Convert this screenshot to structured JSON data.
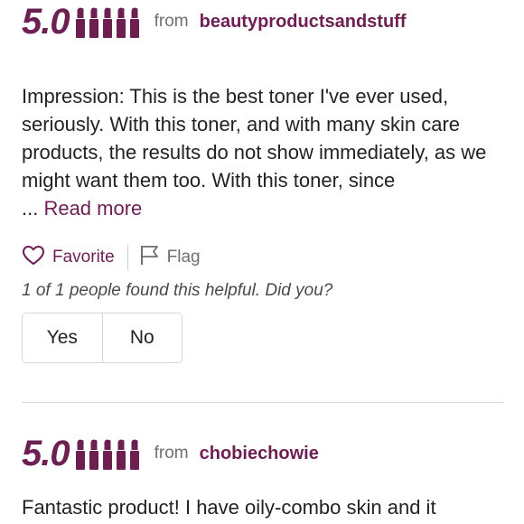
{
  "reviews": [
    {
      "score": "5.0",
      "rating": 5,
      "from_label": "from",
      "username": "beautyproductsandstuff",
      "text": "Impression: This is the best toner I've ever used, seriously. With this toner, and with many skin care products, the results do not show immediately, as we might want them too. With this toner, since",
      "ellipsis": "... ",
      "read_more": "Read more",
      "favorite_label": "Favorite",
      "flag_label": "Flag",
      "helpful_text": "1 of 1 people found this helpful. Did you?",
      "yes_label": "Yes",
      "no_label": "No"
    },
    {
      "score": "5.0",
      "rating": 5,
      "from_label": "from",
      "username": "chobiechowie",
      "text": "Fantastic product! I have oily-combo skin and it"
    }
  ],
  "colors": {
    "accent": "#6d1f52",
    "muted_text": "#6f6f6f",
    "border": "#d6d6d6"
  },
  "icons": {
    "rating": "lipstick-icon",
    "favorite": "heart-outline-icon",
    "flag": "flag-outline-icon"
  }
}
